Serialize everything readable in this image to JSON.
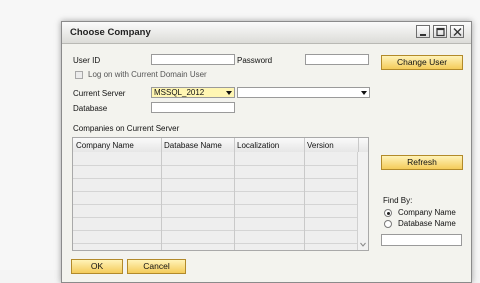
{
  "dialog": {
    "title": "Choose Company"
  },
  "login": {
    "user_id_label": "User ID",
    "user_id_value": "",
    "password_label": "Password",
    "password_value": "",
    "domain_checkbox_label": "Log on with Current Domain User",
    "domain_checkbox_checked": false,
    "current_server_label": "Current Server",
    "current_server_value": "MSSQL_2012",
    "server_name_value": "",
    "database_label": "Database",
    "database_value": ""
  },
  "companies": {
    "section_label": "Companies on Current Server",
    "columns": [
      "Company Name",
      "Database Name",
      "Localization",
      "Version"
    ],
    "rows": []
  },
  "buttons": {
    "change_user": "Change User",
    "refresh": "Refresh",
    "ok": "OK",
    "cancel": "Cancel"
  },
  "find_by": {
    "label": "Find By:",
    "options": [
      "Company Name",
      "Database Name"
    ],
    "selected": "Company Name",
    "search_value": ""
  },
  "icons": {
    "minimize": "minimize-icon",
    "maximize": "maximize-icon",
    "close": "close-icon",
    "expand": "expand-arrow-icon"
  },
  "colors": {
    "button_fill": "#f4cb5a",
    "button_border": "#b28a2a",
    "selected_field": "#fff6b3"
  }
}
